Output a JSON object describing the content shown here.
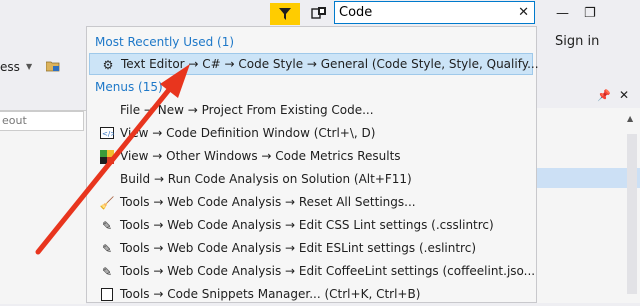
{
  "search": {
    "value": "Code",
    "clear_glyph": "✕"
  },
  "window": {
    "minimize_glyph": "—",
    "restore_glyph": "❐",
    "signin_label": "Sign in"
  },
  "toolbar": {
    "left_text": "ess"
  },
  "left_panel": {
    "input_text": "eout"
  },
  "dropdown": {
    "recent_header": "Most Recently Used (1)",
    "recent_items": [
      {
        "icon": "gear-icon",
        "text": "Text Editor → C# → Code Style → General (Code Style, Style, Qualify..."
      }
    ],
    "menus_header": "Menus (15)",
    "menu_items": [
      {
        "icon": "none",
        "text": "File → New → Project From Existing Code..."
      },
      {
        "icon": "code-definition-window-icon",
        "text": "View → Code Definition Window (Ctrl+\\, D)"
      },
      {
        "icon": "code-metrics-icon",
        "text": "View → Other Windows → Code Metrics Results"
      },
      {
        "icon": "none",
        "text": "Build → Run Code Analysis on Solution (Alt+F11)"
      },
      {
        "icon": "broom-icon",
        "text": "Tools → Web Code Analysis → Reset All Settings..."
      },
      {
        "icon": "pencil-icon",
        "text": "Tools → Web Code Analysis → Edit CSS Lint settings (.csslintrc)"
      },
      {
        "icon": "pencil-icon",
        "text": "Tools → Web Code Analysis → Edit ESLint settings (.eslintrc)"
      },
      {
        "icon": "pencil-icon",
        "text": "Tools → Web Code Analysis → Edit CoffeeLint settings (coffeelint.jso..."
      },
      {
        "icon": "snippet-icon",
        "text": "Tools → Code Snippets Manager... (Ctrl+K, Ctrl+B)"
      }
    ]
  },
  "colors": {
    "accent": "#007acc",
    "feedback": "#ffcc00",
    "selection": "#cce4f7",
    "annotation_arrow": "#e8351e"
  }
}
